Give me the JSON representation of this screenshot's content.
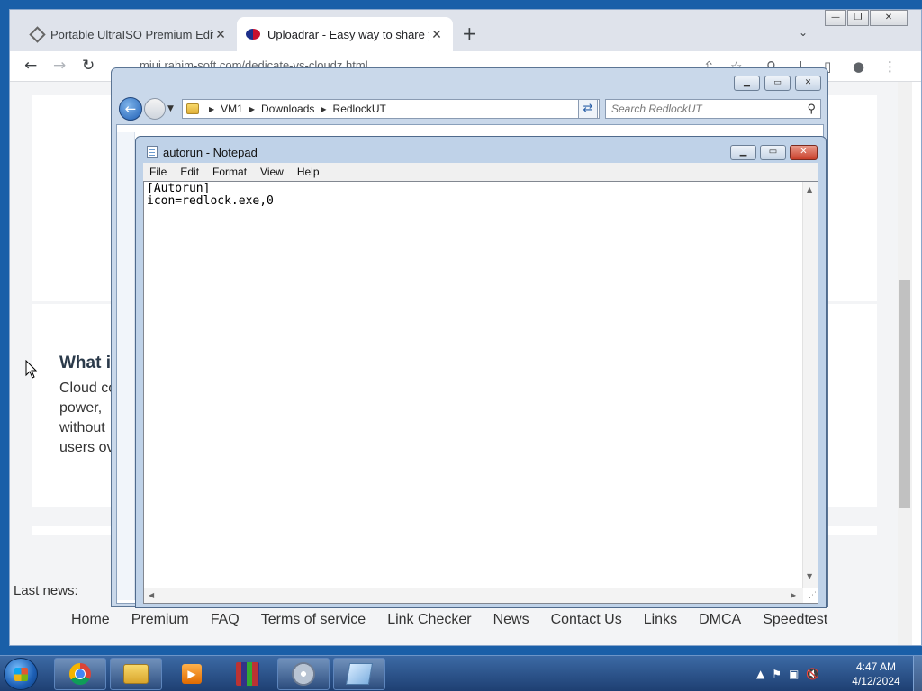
{
  "browser": {
    "tabs": [
      {
        "title": "Portable UltraISO Premium Editic",
        "active": false
      },
      {
        "title": "Uploadrar - Easy way to share yo",
        "active": true
      }
    ],
    "url": "miui.rahim-soft.com/dedicate-vs-cloudz.html",
    "page": {
      "heading": "What i",
      "body_lines": [
        "Cloud co",
        "power,",
        "without",
        "users ov"
      ],
      "last_news": "Last news:",
      "footer_links": [
        "Home",
        "Premium",
        "FAQ",
        "Terms of service",
        "Link Checker",
        "News",
        "Contact Us",
        "Links",
        "DMCA",
        "Speedtest"
      ]
    }
  },
  "explorer": {
    "breadcrumb": [
      "VM1",
      "Downloads",
      "RedlockUT"
    ],
    "search_placeholder": "Search RedlockUT"
  },
  "notepad": {
    "title": "autorun - Notepad",
    "menu": [
      "File",
      "Edit",
      "Format",
      "View",
      "Help"
    ],
    "content_lines": [
      "[Autorun]",
      "icon=redlock.exe,0"
    ]
  },
  "taskbar": {
    "clock_time": "4:47 AM",
    "clock_date": "4/12/2024"
  }
}
